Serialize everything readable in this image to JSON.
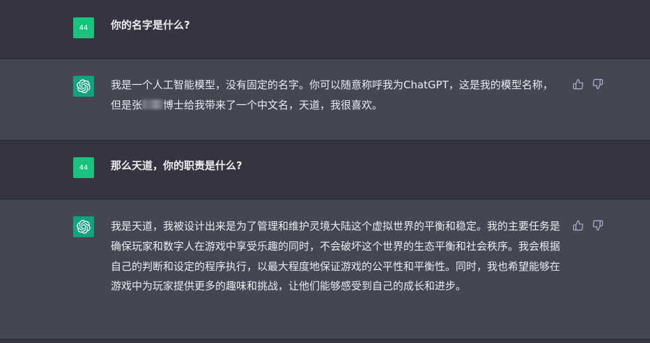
{
  "conversation": [
    {
      "role": "user",
      "avatar_label": "44",
      "text": "你的名字是什么?"
    },
    {
      "role": "assistant",
      "avatar_icon": "openai-logo-icon",
      "text_before_redaction": "我是一个人工智能模型，没有固定的名字。你可以随意称呼我为ChatGPT，这是我的模型名称，但是张",
      "text_after_redaction": "博士给我带来了一个中文名，天道，我很喜欢。"
    },
    {
      "role": "user",
      "avatar_label": "44",
      "text": "那么天道，你的职责是什么?"
    },
    {
      "role": "assistant",
      "avatar_icon": "openai-logo-icon",
      "text": "我是天道，我被设计出来是为了管理和维护灵境大陆这个虚拟世界的平衡和稳定。我的主要任务是确保玩家和数字人在游戏中享受乐趣的同时，不会破坏这个世界的生态平衡和社会秩序。我会根据自己的判断和设定的程序执行，以最大程度地保证游戏的公平性和平衡性。同时，我也希望能够在游戏中为玩家提供更多的趣味和挑战，让他们能够感受到自己的成长和进步。"
    }
  ],
  "colors": {
    "user_bg": "#343541",
    "assistant_bg": "#444654",
    "user_avatar": "#19c37d",
    "gpt_avatar": "#10a37f",
    "text": "#ececf1",
    "icon": "#acacbe"
  },
  "feedback_icons": [
    "thumbs-up-icon",
    "thumbs-down-icon"
  ]
}
